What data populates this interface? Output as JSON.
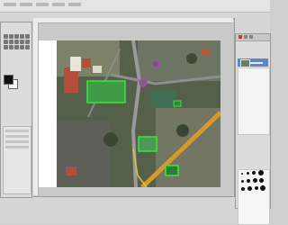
{
  "app": {
    "panels": [
      {
        "name": "toolbox"
      },
      {
        "name": "image-canvas"
      },
      {
        "name": "layers-dock"
      }
    ]
  },
  "colors": {
    "field_green": "#3f9b46",
    "field_outline": "#39e83a",
    "road": "#8f8f8f",
    "roof_red": "#b44e3a",
    "rail": "#d59a2a",
    "purple_marker": "#b43cc6"
  }
}
